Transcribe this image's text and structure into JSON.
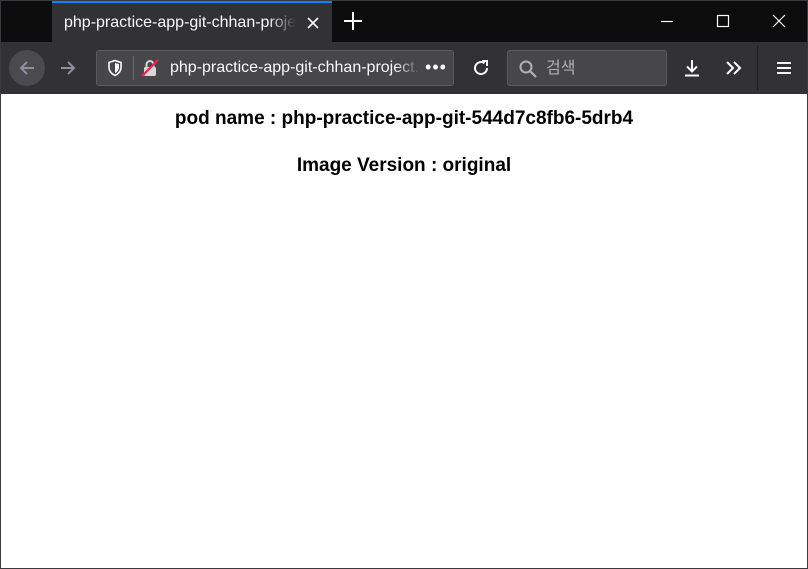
{
  "tab": {
    "title": "php-practice-app-git-chhan-project.apps.ocp.example.com"
  },
  "navbar": {
    "url": "php-practice-app-git-chhan-project.apps.ocp.example.com",
    "search_placeholder": "검색"
  },
  "icons": {
    "tab_close": "close-icon",
    "new_tab": "plus-icon",
    "minimize": "minimize-icon",
    "maximize": "maximize-icon",
    "close_window": "close-icon",
    "back": "arrow-left-icon",
    "forward": "arrow-right-icon",
    "tracking": "shield-icon",
    "insecure": "insecure-lock-icon",
    "page_actions": "ellipsis-icon",
    "reload": "reload-icon",
    "search": "search-icon",
    "downloads": "download-icon",
    "overflow": "chevron-double-right-icon",
    "menu": "hamburger-icon"
  },
  "colors": {
    "tab_accent": "#0a84ff",
    "toolbar_bg": "#323234",
    "tabstrip_bg": "#0c0c0d",
    "insecure_red": "#e22850"
  },
  "page": {
    "pod_name_line": "pod name : php-practice-app-git-544d7c8fb6-5drb4",
    "image_version_line": "Image Version : original"
  }
}
